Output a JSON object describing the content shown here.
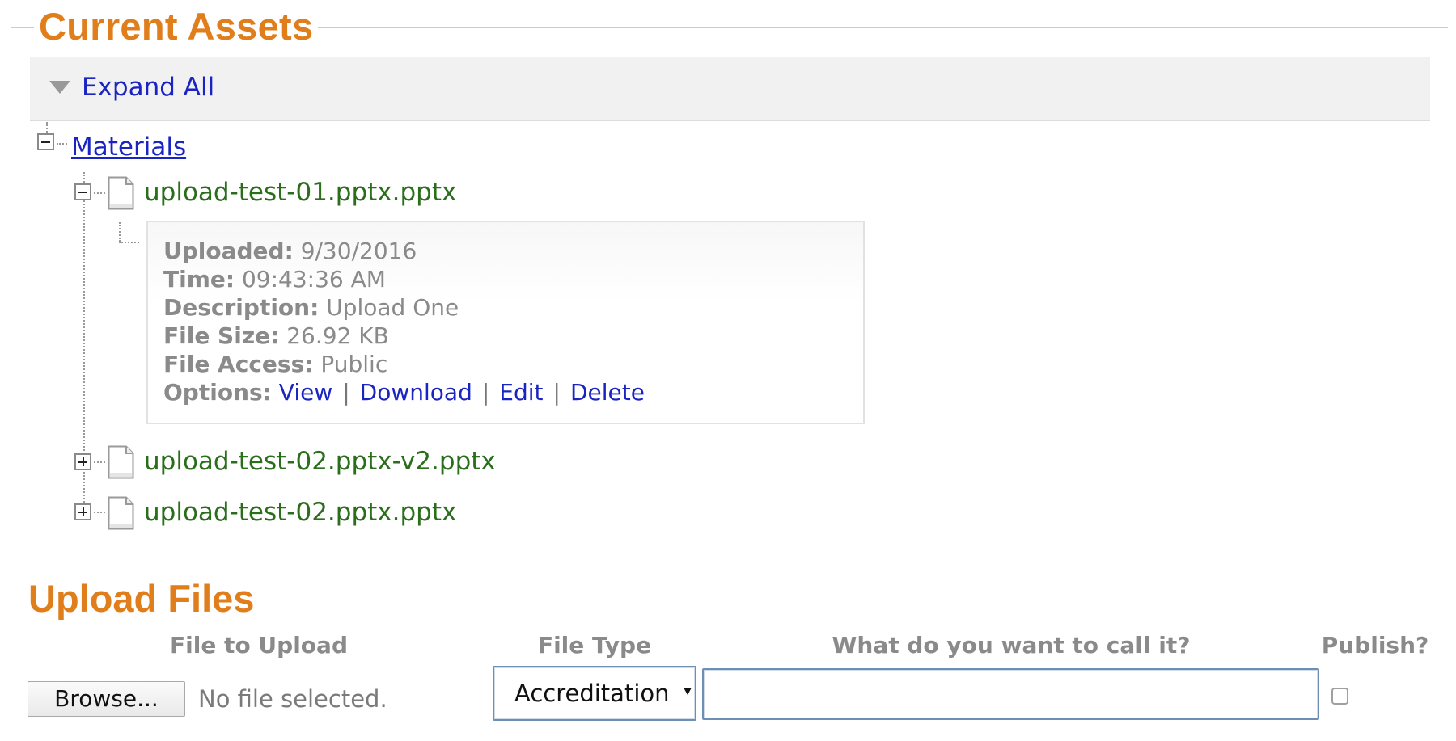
{
  "current_assets": {
    "title": "Current Assets",
    "expand_all_label": "Expand All",
    "tree": {
      "folder_label": "Materials",
      "files": [
        {
          "name": "upload-test-01.pptx.pptx",
          "expanded": true,
          "details": {
            "uploaded_label": "Uploaded:",
            "uploaded_value": "9/30/2016",
            "time_label": "Time:",
            "time_value": "09:43:36 AM",
            "description_label": "Description:",
            "description_value": "Upload One",
            "file_size_label": "File Size:",
            "file_size_value": "26.92 KB",
            "file_access_label": "File Access:",
            "file_access_value": "Public",
            "options_label": "Options:",
            "options": [
              "View",
              "Download",
              "Edit",
              "Delete"
            ],
            "option_separator": "|"
          }
        },
        {
          "name": "upload-test-02.pptx-v2.pptx",
          "expanded": false
        },
        {
          "name": "upload-test-02.pptx.pptx",
          "expanded": false
        }
      ]
    }
  },
  "upload_files": {
    "title": "Upload Files",
    "columns": {
      "file": "File to Upload",
      "type": "File Type",
      "name": "What do you want to call it?",
      "publish": "Publish?"
    },
    "browse_label": "Browse...",
    "no_file_text": "No file selected.",
    "file_type_selected": "Accreditation",
    "name_value": "",
    "publish_checked": false
  },
  "colors": {
    "heading": "#e07e1c",
    "link": "#1a24c2",
    "file_name": "#2a6e1c",
    "muted_text": "#8a8a8a"
  },
  "icons": [
    "collapse-arrow-icon",
    "collapse-toggle-icon",
    "expand-toggle-icon",
    "document-icon"
  ]
}
